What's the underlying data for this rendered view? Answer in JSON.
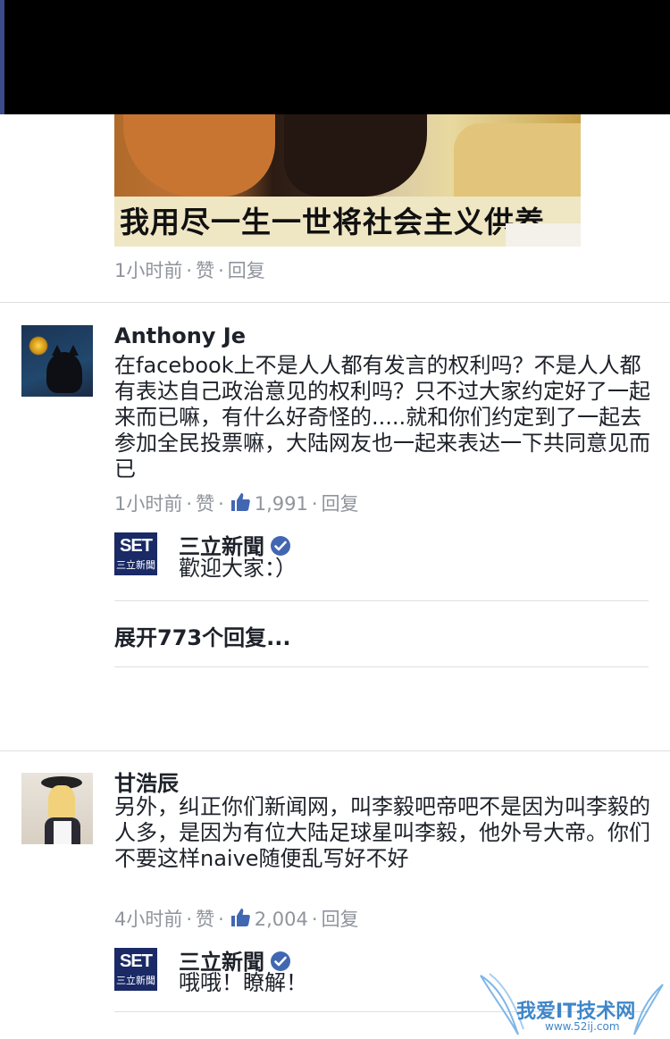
{
  "post_image": {
    "caption": "我用尽一生一世将社会主义供养"
  },
  "post_meta": {
    "time": "1小时前",
    "like": "赞",
    "reply": "回复"
  },
  "comments": [
    {
      "author": "Anthony Je",
      "text": "在facebook上不是人人都有发言的权利吗？不是人人都有表达自己政治意见的权利吗？只不过大家约定好了一起来而已嘛，有什么好奇怪的.....就和你们约定到了一起去参加全民投票嘛，大陆网友也一起来表达一下共同意见而已",
      "time": "1小时前",
      "like": "赞",
      "like_count": "1,991",
      "reply": "回复",
      "page_reply": {
        "author": "三立新聞",
        "text": "歡迎大家：）"
      },
      "expand_replies": "展开773个回复..."
    },
    {
      "author": "甘浩辰",
      "text": "另外，纠正你们新闻网，叫李毅吧帝吧不是因为叫李毅的人多，是因为有位大陆足球星叫李毅，他外号大帝。你们不要这样naive随便乱写好不好",
      "time": "4小时前",
      "like": "赞",
      "like_count": "2,004",
      "reply": "回复",
      "page_reply": {
        "author": "三立新聞",
        "text": "哦哦！瞭解！"
      }
    }
  ],
  "page_avatar": {
    "logo": "SET",
    "sub": "三立新聞"
  },
  "watermark": {
    "text": "我爱IT技术网",
    "url": "www.52ij.com"
  },
  "colors": {
    "meta": "#90949c",
    "verified": "#4267b2",
    "set_logo": "#1a2a66"
  },
  "icons": {
    "like": "thumbs-up-icon",
    "verified": "verified-badge-icon"
  }
}
